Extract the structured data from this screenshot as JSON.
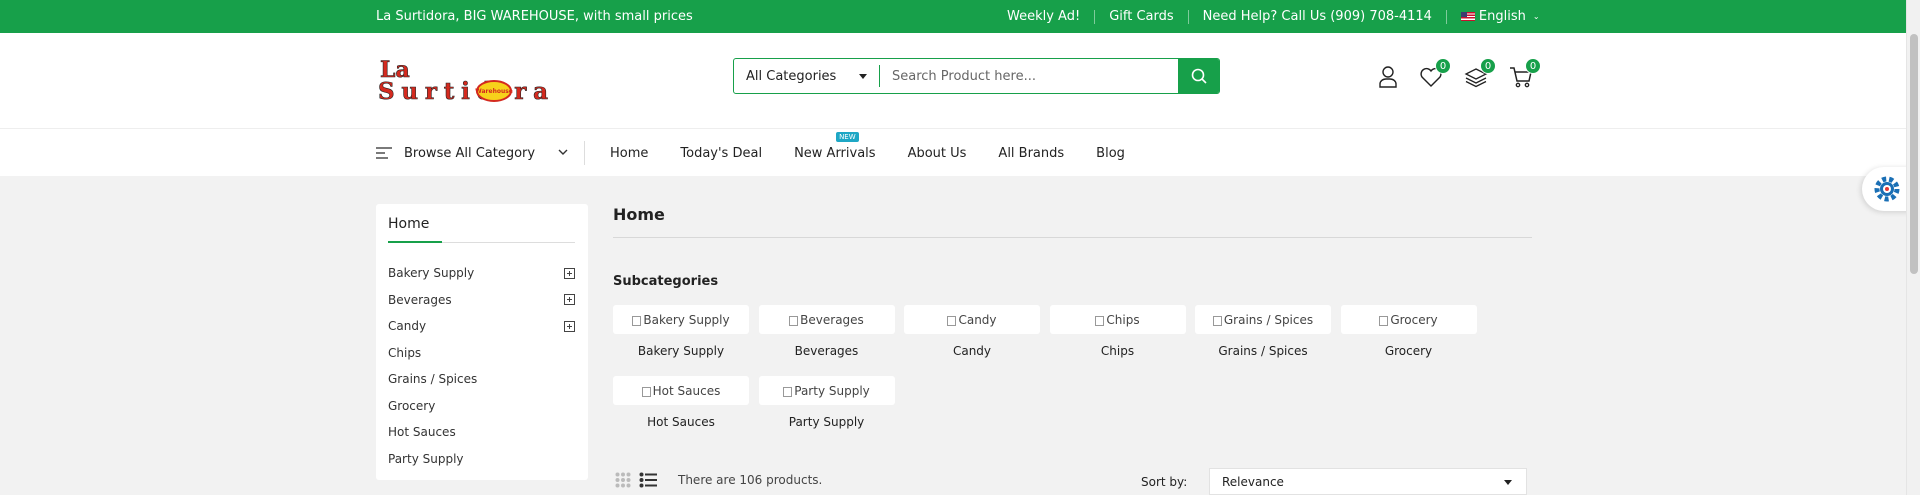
{
  "topbar": {
    "promo": "La Surtidora, BIG WAREHOUSE, with small prices",
    "links": [
      "Weekly Ad!",
      "Gift Cards",
      "Need Help? Call Us (909) 708-4114"
    ],
    "language": "English"
  },
  "header": {
    "logo_text": "La Surtidora",
    "logo_badge": "Warehouse",
    "search_category": "All Categories",
    "search_placeholder": "Search Product here...",
    "wishlist_count": "0",
    "compare_count": "0",
    "cart_count": "0"
  },
  "nav": {
    "browse_label": "Browse All Category",
    "items": [
      "Home",
      "Today's Deal",
      "New Arrivals",
      "About Us",
      "All Brands",
      "Blog"
    ],
    "new_tag": "NEW"
  },
  "sidebar": {
    "title": "Home",
    "items": [
      {
        "label": "Bakery Supply",
        "expandable": true
      },
      {
        "label": "Beverages",
        "expandable": true
      },
      {
        "label": "Candy",
        "expandable": true
      },
      {
        "label": "Chips",
        "expandable": false
      },
      {
        "label": "Grains / Spices",
        "expandable": false
      },
      {
        "label": "Grocery",
        "expandable": false
      },
      {
        "label": "Hot Sauces",
        "expandable": false
      },
      {
        "label": "Party Supply",
        "expandable": false
      }
    ]
  },
  "main": {
    "title": "Home",
    "subcategories_heading": "Subcategories",
    "subcategories": [
      {
        "alt": "Bakery Supply",
        "label": "Bakery Supply"
      },
      {
        "alt": "Beverages",
        "label": "Beverages"
      },
      {
        "alt": "Candy",
        "label": "Candy"
      },
      {
        "alt": "Chips",
        "label": "Chips"
      },
      {
        "alt": "Grains / Spices",
        "label": "Grains / Spices"
      },
      {
        "alt": "Grocery",
        "label": "Grocery"
      },
      {
        "alt": "Hot Sauces",
        "label": "Hot Sauces"
      },
      {
        "alt": "Party Supply",
        "label": "Party Supply"
      }
    ],
    "product_count_text": "There are 106 products.",
    "sort_label": "Sort by:",
    "sort_value": "Relevance"
  },
  "colors": {
    "brand_green": "#17a04a",
    "logo_red": "#d42a1f",
    "logo_yellow": "#f7d21b",
    "new_tag": "#1ea7c5"
  },
  "icons": [
    "search-icon",
    "user-icon",
    "heart-icon",
    "layers-icon",
    "cart-icon",
    "menu-lines-icon",
    "chevron-down-icon",
    "plus-box-icon",
    "grid-view-icon",
    "list-view-icon",
    "gear-icon"
  ]
}
